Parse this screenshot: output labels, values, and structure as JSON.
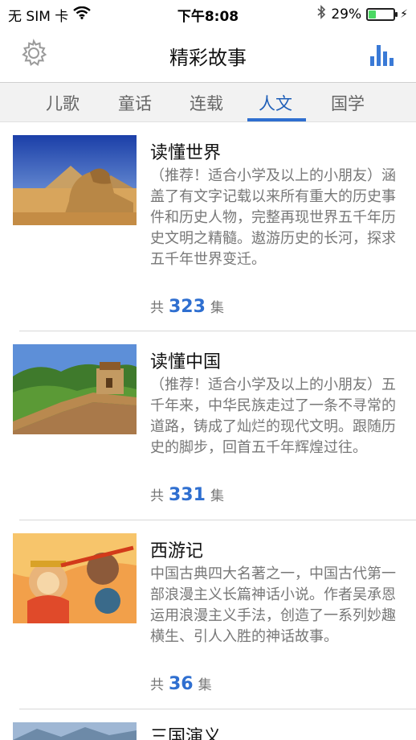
{
  "status_bar": {
    "carrier": "无 SIM 卡",
    "time": "下午8:08",
    "battery_percent_text": "29%",
    "battery_level": 0.29,
    "icons": [
      "wifi-icon",
      "bluetooth-icon",
      "battery-icon",
      "charging-icon"
    ]
  },
  "navbar": {
    "title": "精彩故事",
    "left_icon": "gear-icon",
    "right_icon": "bar-chart-icon"
  },
  "tabs": [
    {
      "label": "儿歌",
      "active": false
    },
    {
      "label": "童话",
      "active": false
    },
    {
      "label": "连载",
      "active": false
    },
    {
      "label": "人文",
      "active": true
    },
    {
      "label": "国学",
      "active": false
    }
  ],
  "stories": [
    {
      "title": "读懂世界",
      "description": "（推荐！适合小学及以上的小朋友）涵盖了有文字记载以来所有重大的历史事件和历史人物，完整再现世界五千年历史文明之精髓。遨游历史的长河，探求五千年世界变迁。",
      "count_prefix": "共",
      "count": "323",
      "count_suffix": "集",
      "image": "egypt-sphinx-pyramid"
    },
    {
      "title": "读懂中国",
      "description": "（推荐！适合小学及以上的小朋友）五千年来，中华民族走过了一条不寻常的道路，铸成了灿烂的现代文明。跟随历史的脚步，回首五千年辉煌过往。",
      "count_prefix": "共",
      "count": "331",
      "count_suffix": "集",
      "image": "great-wall"
    },
    {
      "title": "西游记",
      "description": "中国古典四大名著之一，中国古代第一部浪漫主义长篇神话小说。作者吴承恩运用浪漫主义手法，创造了一系列妙趣横生、引人入胜的神话故事。",
      "count_prefix": "共",
      "count": "36",
      "count_suffix": "集",
      "image": "journey-to-the-west-cartoon"
    },
    {
      "title": "三国演义",
      "image": "three-kingdoms-cartoon"
    }
  ],
  "colors": {
    "accent": "#2f6fd0",
    "tab_bar_bg": "#f2f2f2",
    "desc_text": "#777777"
  }
}
